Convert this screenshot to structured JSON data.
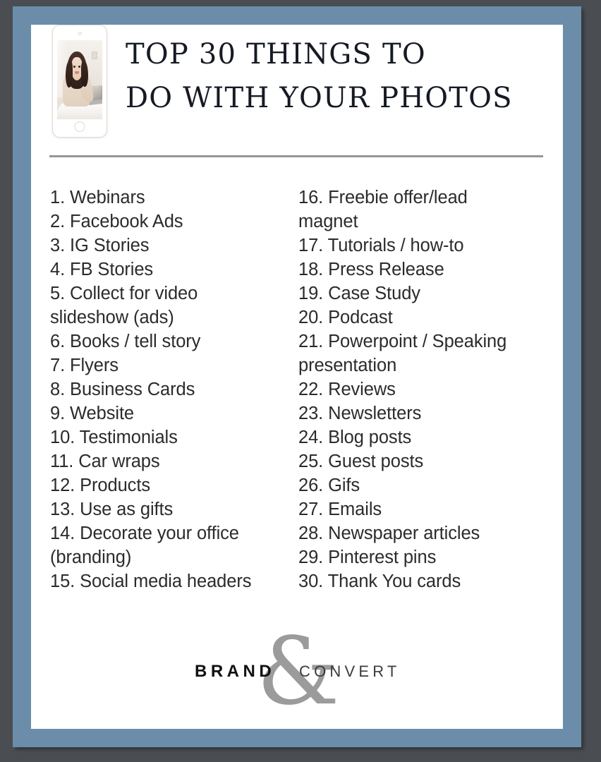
{
  "frame": {
    "outer_background": "#4a4e52",
    "border_color": "#6b8da9",
    "card_background": "#ffffff",
    "divider_color": "#939598"
  },
  "header": {
    "device_mockup": {
      "name": "iphone-mockup",
      "photo_description": "Smiling woman with dark wavy hair in a cream off-shoulder sweater seated at a white desk with a laptop"
    },
    "title_line_1": "TOP 30 THINGS TO",
    "title_line_2": "DO WITH YOUR PHOTOS",
    "title_color": "#151a24"
  },
  "list": {
    "text_color": "#2b2b2b",
    "left_column": [
      "1. Webinars",
      "2. Facebook Ads",
      "3. IG Stories",
      "4. FB Stories",
      "5. Collect for video",
      "slideshow (ads)",
      "6. Books / tell story",
      "7. Flyers",
      "8. Business Cards",
      "9. Website",
      "10. Testimonials",
      "11. Car wraps",
      "12. Products",
      "13. Use as gifts",
      "14. Decorate your office",
      "(branding)",
      "15. Social media headers"
    ],
    "right_column": [
      "16. Freebie offer/lead",
      "magnet",
      "17. Tutorials / how-to",
      "18. Press Release",
      "19. Case Study",
      "20. Podcast",
      "21. Powerpoint / Speaking",
      "presentation",
      "22. Reviews",
      "23. Newsletters",
      "24. Blog posts",
      "25. Guest posts",
      "26. Gifs",
      "27. Emails",
      "28. Newspaper articles",
      "29. Pinterest pins",
      "30. Thank You cards"
    ]
  },
  "logo": {
    "brand_word": "BRAND",
    "convert_word": "CONVERT",
    "ampersand": "&",
    "ampersand_color": "#9b9b9b",
    "brand_color": "#111111",
    "convert_color": "#3b3b3b"
  }
}
